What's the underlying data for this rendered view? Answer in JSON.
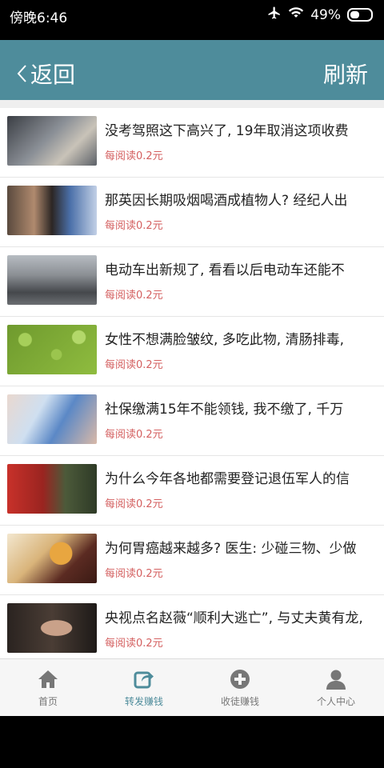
{
  "status_bar": {
    "time": "傍晚6:46",
    "battery": "49%"
  },
  "header": {
    "back_label": "返回",
    "refresh_label": "刷新"
  },
  "items": [
    {
      "title": "没考驾照这下高兴了, 19年取消这项收费",
      "reward": "每阅读0.2元"
    },
    {
      "title": "那英因长期吸烟喝酒成植物人? 经纪人出",
      "reward": "每阅读0.2元"
    },
    {
      "title": "电动车出新规了, 看看以后电动车还能不",
      "reward": "每阅读0.2元"
    },
    {
      "title": "女性不想满脸皱纹, 多吃此物, 清肠排毒,",
      "reward": "每阅读0.2元"
    },
    {
      "title": "社保缴满15年不能领钱, 我不缴了, 千万",
      "reward": "每阅读0.2元"
    },
    {
      "title": "为什么今年各地都需要登记退伍军人的信",
      "reward": "每阅读0.2元"
    },
    {
      "title": "为何胃癌越来越多? 医生: 少碰三物、少做",
      "reward": "每阅读0.2元"
    },
    {
      "title": "央视点名赵薇“顺利大逃亡”, 与丈夫黄有龙,",
      "reward": "每阅读0.2元"
    }
  ],
  "tabs": [
    {
      "label": "首页",
      "icon": "home-icon"
    },
    {
      "label": "转发赚钱",
      "icon": "share-icon",
      "active": true
    },
    {
      "label": "收徒赚钱",
      "icon": "plus-circle-icon"
    },
    {
      "label": "个人中心",
      "icon": "person-icon"
    }
  ],
  "colors": {
    "header": "#4e8c9b",
    "reward": "#d46060",
    "active_tab": "#4e8c9b"
  }
}
